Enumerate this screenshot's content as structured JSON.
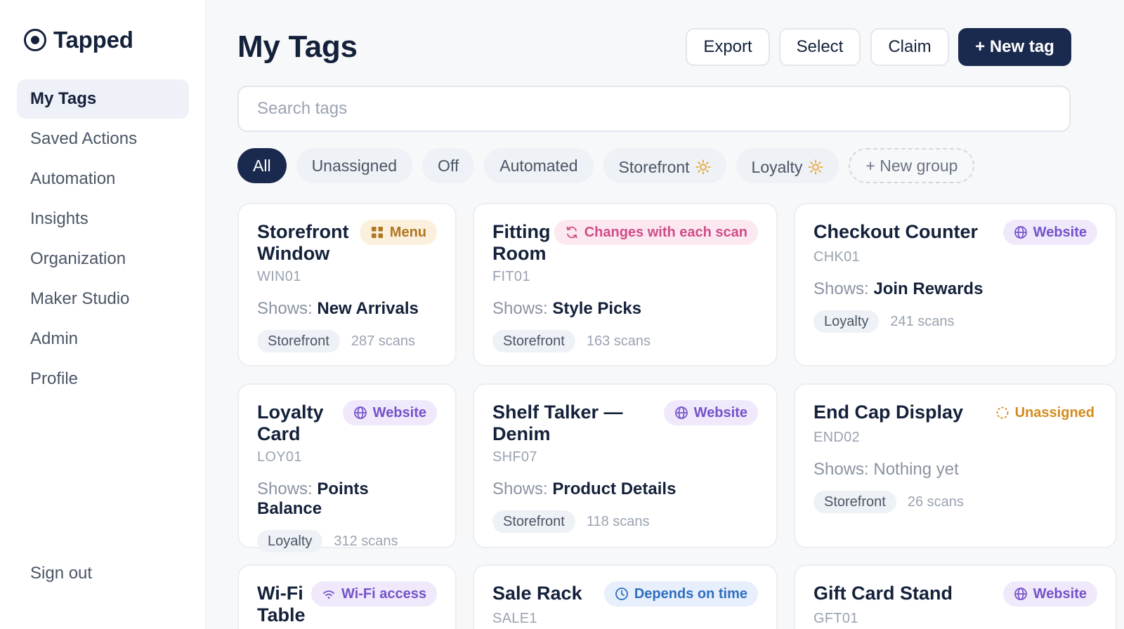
{
  "app": {
    "name": "Tapped"
  },
  "sidebar": {
    "items": [
      {
        "label": "My Tags",
        "active": true
      },
      {
        "label": "Saved Actions"
      },
      {
        "label": "Automation"
      },
      {
        "label": "Insights"
      },
      {
        "label": "Organization"
      },
      {
        "label": "Maker Studio"
      },
      {
        "label": "Admin"
      },
      {
        "label": "Profile"
      }
    ],
    "signout": "Sign out"
  },
  "header": {
    "title": "My Tags",
    "export": "Export",
    "select": "Select",
    "claim": "Claim",
    "new_tag": "+ New tag"
  },
  "search": {
    "placeholder": "Search tags",
    "value": ""
  },
  "filters": {
    "all": "All",
    "unassigned": "Unassigned",
    "off": "Off",
    "automated": "Automated",
    "storefront": "Storefront",
    "loyalty": "Loyalty",
    "new_group": "+ New group"
  },
  "colors": {
    "primary": "#1a2a4f",
    "background": "#f7f8fa",
    "sun": "#e9a638"
  },
  "shows_label": "Shows:",
  "cards": [
    {
      "title": "Storefront Window",
      "code": "WIN01",
      "badge": "Menu",
      "badge_icon": "grid-icon",
      "shows": "New Arrivals",
      "group": "Storefront",
      "scans": "287 scans"
    },
    {
      "title": "Fitting Room",
      "code": "FIT01",
      "badge": "Changes with each scan",
      "badge_icon": "refresh-icon",
      "shows": "Style Picks",
      "group": "Storefront",
      "scans": "163 scans"
    },
    {
      "title": "Checkout Counter",
      "code": "CHK01",
      "badge": "Website",
      "badge_icon": "globe-icon",
      "shows": "Join Rewards",
      "group": "Loyalty",
      "scans": "241 scans"
    },
    {
      "title": "Loyalty Card",
      "code": "LOY01",
      "badge": "Website",
      "badge_icon": "globe-icon",
      "shows": "Points Balance",
      "group": "Loyalty",
      "scans": "312 scans"
    },
    {
      "title": "Shelf Talker — Denim",
      "code": "SHF07",
      "badge": "Website",
      "badge_icon": "globe-icon",
      "shows": "Product Details",
      "group": "Storefront",
      "scans": "118 scans"
    },
    {
      "title": "End Cap Display",
      "code": "END02",
      "badge": "Unassigned",
      "badge_icon": "dashed-circle-icon",
      "shows": "Nothing yet",
      "group": "Storefront",
      "scans": "26 scans"
    },
    {
      "title": "Wi-Fi Table",
      "code": "",
      "badge": "Wi-Fi access",
      "badge_icon": "wifi-icon"
    },
    {
      "title": "Sale Rack",
      "code": "SALE1",
      "badge": "Depends on time",
      "badge_icon": "clock-icon"
    },
    {
      "title": "Gift Card Stand",
      "code": "GFT01",
      "badge": "Website",
      "badge_icon": "globe-icon"
    }
  ]
}
